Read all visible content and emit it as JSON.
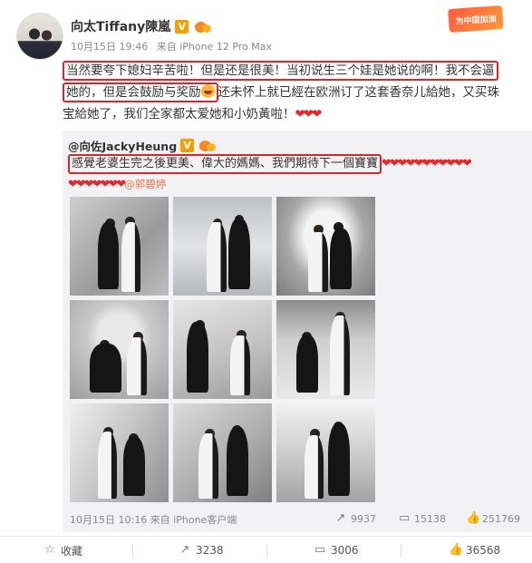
{
  "post": {
    "author": "向太Tiffany陳嵐",
    "verified_mark": "V",
    "time": "10月15日 19:46",
    "source": "来自 iPhone 12 Pro Max",
    "corner_badge": "为中国加油",
    "text_lines": [
      {
        "before": "",
        "highlight": "当然要夸下媳妇辛苦啦！但是还是很美！当初说生三个娃是她说的啊！我不会逼",
        "after": ""
      },
      {
        "before": "",
        "highlight": "她的，但是会鼓励与奖励",
        "after": "还未怀上就已經在欧洲订了这套香奈儿給她，又买珠"
      },
      {
        "before": "宝給她了，我们全家都太爱她和小奶黃啦！",
        "highlight": "",
        "after": ""
      }
    ],
    "hearts_main": "❤❤❤"
  },
  "repost": {
    "author": "@向佐JackyHeung",
    "verified_mark": "V",
    "text_highlight": "感覺老婆生完之後更美、偉大的媽媽、我們期待下一個寶寶",
    "hearts_line1": "❤❤❤❤❤❤❤❤❤❤❤",
    "hearts_line2": "❤❤❤❤❤❤❤",
    "mention": "@郭碧婷",
    "footer": {
      "time": "10月15日 10:16 来自 iPhone客户端",
      "reposts": "9937",
      "comments": "15138",
      "likes": "251769"
    }
  },
  "actions": {
    "favorite": "收藏",
    "repost": "3238",
    "comment": "3006",
    "like": "36568"
  },
  "icons": {
    "favorite": "star-icon",
    "repost": "share-icon",
    "comment": "comment-icon",
    "like": "thumbs-up-icon"
  },
  "colors": {
    "highlight_box": "#d8272a",
    "heart": "#e2292b",
    "mention": "#eb7350",
    "repost_bg": "#f2f2f5"
  }
}
